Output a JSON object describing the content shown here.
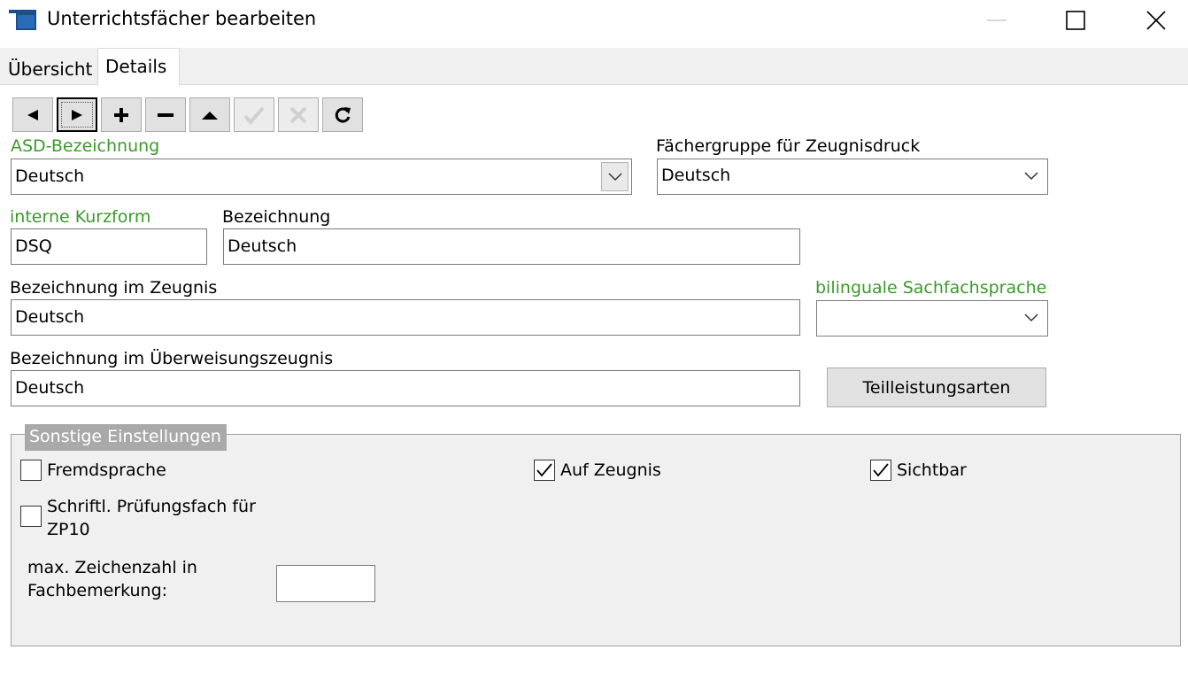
{
  "window": {
    "title": "Unterrichtsfächer bearbeiten",
    "minimize_icon": "minimize-icon",
    "maximize_icon": "maximize-icon",
    "close_icon": "close-icon"
  },
  "tabs": [
    {
      "label": "Übersicht",
      "active": false
    },
    {
      "label": "Details",
      "active": true
    }
  ],
  "toolbar": {
    "buttons": [
      {
        "name": "prev-record",
        "icon": "triangle-left-icon",
        "enabled": true
      },
      {
        "name": "next-record",
        "icon": "triangle-right-icon",
        "enabled": true,
        "focused": true
      },
      {
        "name": "add-record",
        "icon": "plus-icon",
        "enabled": true
      },
      {
        "name": "delete-record",
        "icon": "minus-icon",
        "enabled": true
      },
      {
        "name": "first-record",
        "icon": "triangle-up-icon",
        "enabled": true
      },
      {
        "name": "confirm-edit",
        "icon": "check-icon",
        "enabled": false
      },
      {
        "name": "cancel-edit",
        "icon": "cross-icon",
        "enabled": false
      },
      {
        "name": "refresh",
        "icon": "refresh-icon",
        "enabled": true
      }
    ]
  },
  "form": {
    "asd_label": "ASD-Bezeichnung",
    "asd_value": "Deutsch",
    "faechergruppe_label": "Fächergruppe für Zeugnisdruck",
    "faechergruppe_value": "Deutsch",
    "kurzform_label": "interne Kurzform",
    "kurzform_value": "DSQ",
    "bezeichnung_label": "Bezeichnung",
    "bezeichnung_value": "Deutsch",
    "zeugnis_label": "Bezeichnung im Zeugnis",
    "zeugnis_value": "Deutsch",
    "bilingual_label": "bilinguale Sachfachsprache",
    "bilingual_value": "",
    "ueberweisung_label": "Bezeichnung im Überweisungszeugnis",
    "ueberweisung_value": "Deutsch",
    "teilleistungsarten_button": "Teilleistungsarten"
  },
  "group": {
    "legend": "Sonstige Einstellungen",
    "fremdsprache_label": "Fremdsprache",
    "fremdsprache_checked": false,
    "auf_zeugnis_label": "Auf Zeugnis",
    "auf_zeugnis_checked": true,
    "sichtbar_label": "Sichtbar",
    "sichtbar_checked": true,
    "pruefungsfach_label_line1": "Schriftl. Prüfungsfach für",
    "pruefungsfach_label_line2": "ZP10",
    "pruefungsfach_checked": false,
    "max_zeichen_label_line1": "max. Zeichenzahl in",
    "max_zeichen_label_line2": "Fachbemerkung:",
    "max_zeichen_value": ""
  },
  "colors": {
    "required_label": "#3a9a2a",
    "group_legend_bg": "#a9a9a9",
    "app_icon": "#2b6cb8"
  }
}
